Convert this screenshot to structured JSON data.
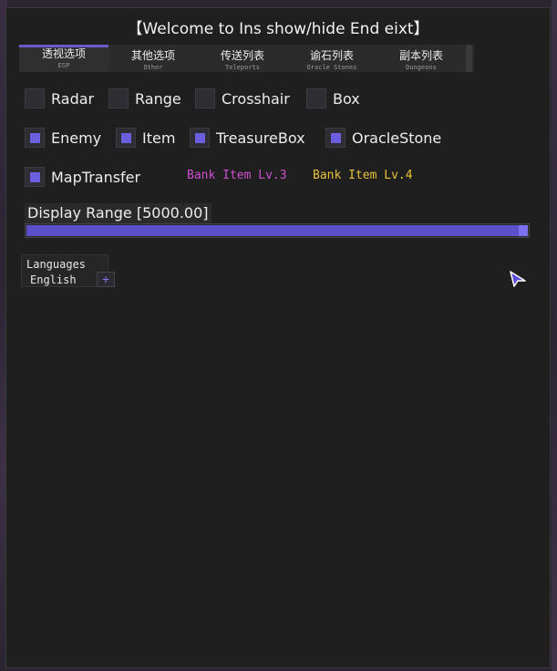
{
  "window": {
    "title": "【Welcome to Ins show/hide End eixt】"
  },
  "tabs": [
    {
      "label": "透视选项",
      "sub": "ESP",
      "active": true
    },
    {
      "label": "其他选项",
      "sub": "Other",
      "active": false
    },
    {
      "label": "传送列表",
      "sub": "Teleports",
      "active": false
    },
    {
      "label": "谕石列表",
      "sub": "Oracle Stones",
      "active": false
    },
    {
      "label": "副本列表",
      "sub": "Dungeons",
      "active": false
    }
  ],
  "options": {
    "radar": {
      "label": "Radar",
      "checked": false
    },
    "range": {
      "label": "Range",
      "checked": false
    },
    "crosshair": {
      "label": "Crosshair",
      "checked": false
    },
    "box": {
      "label": "Box",
      "checked": false
    },
    "enemy": {
      "label": "Enemy",
      "checked": true
    },
    "item": {
      "label": "Item",
      "checked": true
    },
    "treasurebox": {
      "label": "TreasureBox",
      "checked": true
    },
    "oraclestone": {
      "label": "OracleStone",
      "checked": true
    },
    "maptransfer": {
      "label": "MapTransfer",
      "checked": true
    }
  },
  "tags": {
    "bank_lv3": {
      "text": "Bank Item Lv.3",
      "color": "#d04fd0"
    },
    "bank_lv4": {
      "text": "Bank Item Lv.4",
      "color": "#e6c23a"
    }
  },
  "display_range": {
    "label": "Display Range [5000.00]",
    "fraction": 1.0
  },
  "languages": {
    "title": "Languages",
    "value": "English",
    "button": "+"
  },
  "colors": {
    "accent": "#6b5fe0",
    "window_bg": "#1f1f1f"
  }
}
